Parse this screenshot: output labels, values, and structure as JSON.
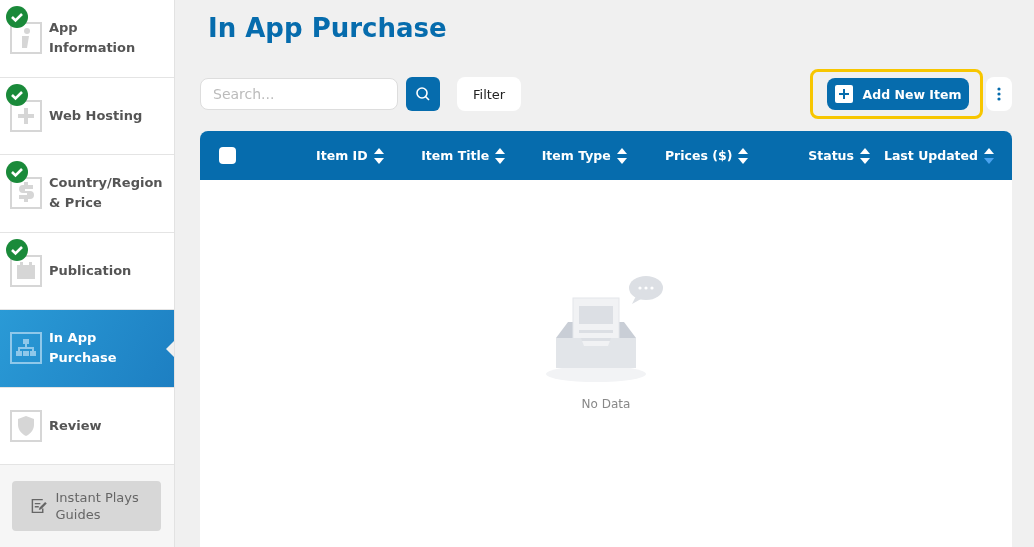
{
  "sidebar": {
    "steps": [
      {
        "label": "App Information",
        "completed": true,
        "selected": false
      },
      {
        "label": "Web Hosting",
        "completed": true,
        "selected": false
      },
      {
        "label": "Country/Region & Price",
        "completed": true,
        "selected": false
      },
      {
        "label": "Publication",
        "completed": true,
        "selected": false
      },
      {
        "label": "In App Purchase",
        "completed": false,
        "selected": true
      },
      {
        "label": "Review",
        "completed": false,
        "selected": false
      }
    ],
    "guide_button": "Instant Plays Guides"
  },
  "page": {
    "title": "In App Purchase"
  },
  "toolbar": {
    "search": {
      "placeholder": "Search..."
    },
    "filter_button": "Filter",
    "add_button": {
      "label": "Add New Item",
      "highlighted": true
    }
  },
  "table": {
    "select_all": {
      "checked": false
    },
    "columns": [
      {
        "label": "Item ID",
        "sorted": false
      },
      {
        "label": "Item Title",
        "sorted": false
      },
      {
        "label": "Item Type",
        "sorted": false
      },
      {
        "label": "Prices ($)",
        "sorted": false
      },
      {
        "label": "Status",
        "sorted": false
      },
      {
        "label": "Last Updated",
        "sorted": true
      }
    ],
    "empty_text": "No Data"
  }
}
